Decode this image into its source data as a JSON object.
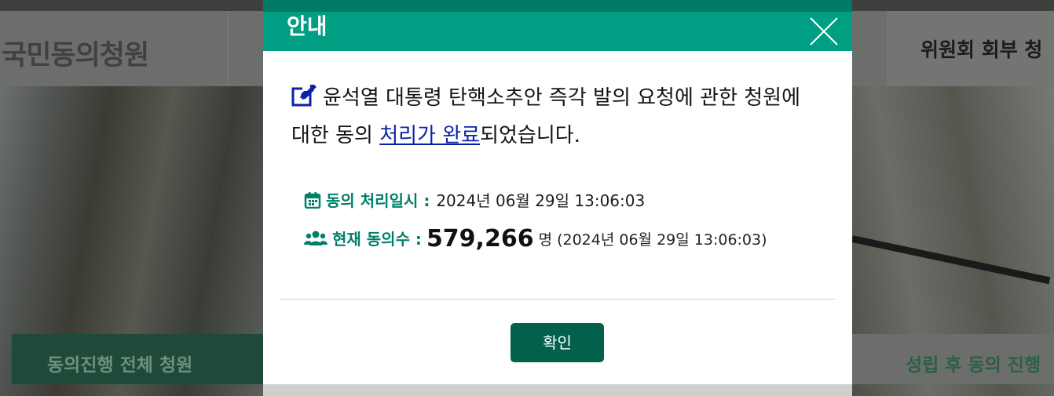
{
  "background": {
    "site_logo": "국민동의청원",
    "header_right_menu": "위원회 회부 청",
    "tab_left": "동의진행 전체 청원",
    "tab_right": "성립 후 동의 진행"
  },
  "modal": {
    "title": "안내",
    "close_icon": "close-icon",
    "message_part1": "윤석열 대통령 탄핵소추안 즉각 발의 요청에 관한 청원에 대한 동의 ",
    "message_link": "처리가 완료",
    "message_part2": "되었습니다.",
    "processed_label": "동의 처리일시 :",
    "processed_value": "2024년 06월 29일 13:06:03",
    "count_label": "현재 동의수 :",
    "count_value": "579,266",
    "count_unit": "명 (2024년 06월 29일 13:06:03)",
    "confirm_label": "확인"
  },
  "colors": {
    "header_green": "#009f83",
    "label_green": "#00806a",
    "button_green": "#03614b",
    "link_blue": "#0b22a8"
  }
}
